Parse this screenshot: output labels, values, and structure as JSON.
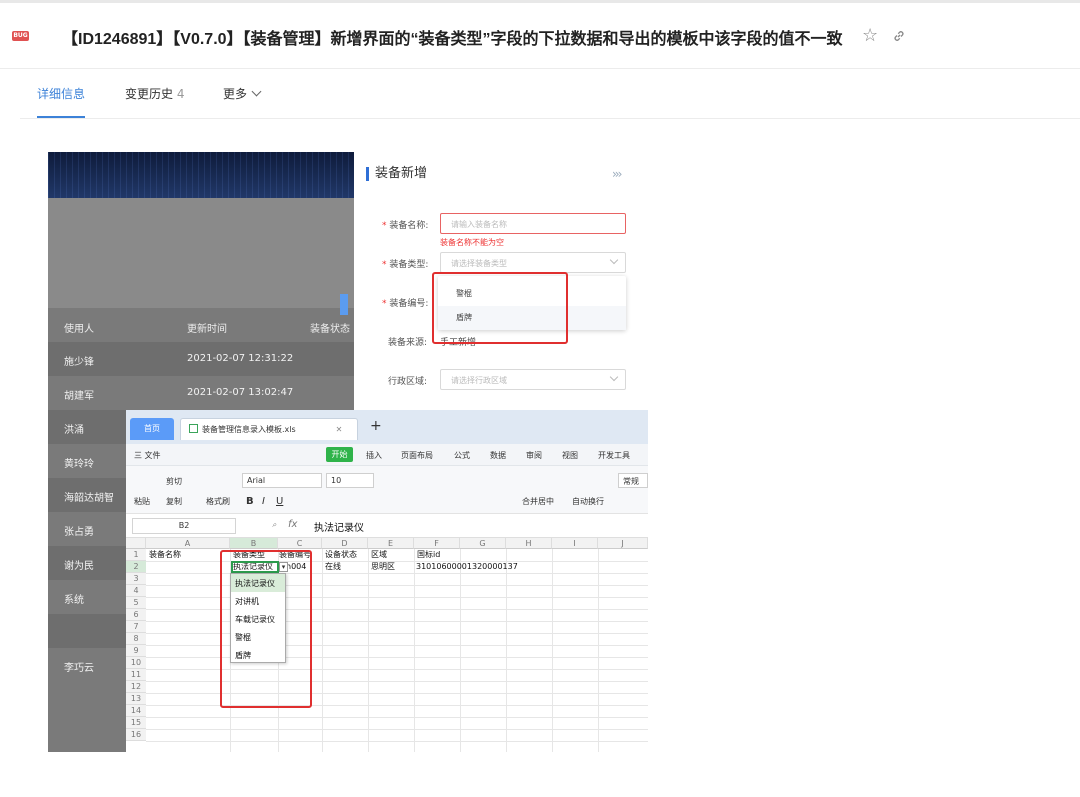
{
  "header": {
    "badge": "BUG",
    "title": "【ID1246891】【V0.7.0】【装备管理】新增界面的“装备类型”字段的下拉数据和导出的模板中该字段的值不一致",
    "star_icon": "star-icon",
    "link_icon": "link-icon"
  },
  "tabs": {
    "detail": "详细信息",
    "history": "变更历史",
    "history_count": "4",
    "more": "更多"
  },
  "screenshot": {
    "list": {
      "headers": [
        "使用人",
        "更新时间",
        "装备状态"
      ],
      "rows": [
        {
          "user": "施少锋",
          "time": "2021-02-07 12:31:22"
        },
        {
          "user": "胡建军",
          "time": "2021-02-07 13:02:47"
        },
        {
          "user": "洪涌",
          "time": ""
        },
        {
          "user": "黄玲玲",
          "time": ""
        },
        {
          "user": "海韶达胡智",
          "time": ""
        },
        {
          "user": "张占勇",
          "time": ""
        },
        {
          "user": "谢为民",
          "time": ""
        },
        {
          "user": "系统",
          "time": ""
        },
        {
          "user": "李巧云",
          "time": ""
        }
      ]
    },
    "form": {
      "title": "装备新增",
      "collapse": "›››",
      "name_label": "装备名称:",
      "name_placeholder": "请输入装备名称",
      "name_error": "装备名称不能为空",
      "type_label": "装备类型:",
      "type_placeholder": "请选择装备类型",
      "type_options": [
        "警棍",
        "盾牌"
      ],
      "code_label": "装备编号:",
      "source_label": "装备来源:",
      "source_value": "手工新增",
      "region_label": "行政区域:",
      "region_placeholder": "请选择行政区域"
    },
    "spreadsheet": {
      "home_tab": "首页",
      "file_tab": "装备管理信息录入模板.xls",
      "menus": [
        "三 文件",
        "开始",
        "插入",
        "页面布局",
        "公式",
        "数据",
        "审阅",
        "视图",
        "开发工具"
      ],
      "toolbar": {
        "paste": "粘贴",
        "cut": "剪切",
        "copy": "复制",
        "format_painter": "格式刷",
        "font": "Arial",
        "size": "10",
        "merge": "合并居中",
        "wrap": "自动换行",
        "normal": "常规"
      },
      "cell_ref": "B2",
      "fx": "fx",
      "formula": "执法记录仪",
      "columns": [
        "A",
        "B",
        "C",
        "D",
        "E",
        "F",
        "G",
        "H",
        "I",
        "J"
      ],
      "rows": [
        "1",
        "2",
        "3",
        "4",
        "5",
        "6",
        "7",
        "8",
        "9",
        "10",
        "11",
        "12",
        "13",
        "14",
        "15",
        "16"
      ],
      "header_row": [
        "装备名称",
        "装备类型",
        "装备编号",
        "设备状态",
        "区域",
        "国标id"
      ],
      "data_row": {
        "b": "执法记录仪",
        "c": "h004",
        "d": "在线",
        "e": "思明区",
        "f": "31010600001320000137"
      },
      "dropdown": [
        "执法记录仪",
        "对讲机",
        "车载记录仪",
        "警棍",
        "盾牌"
      ]
    }
  }
}
